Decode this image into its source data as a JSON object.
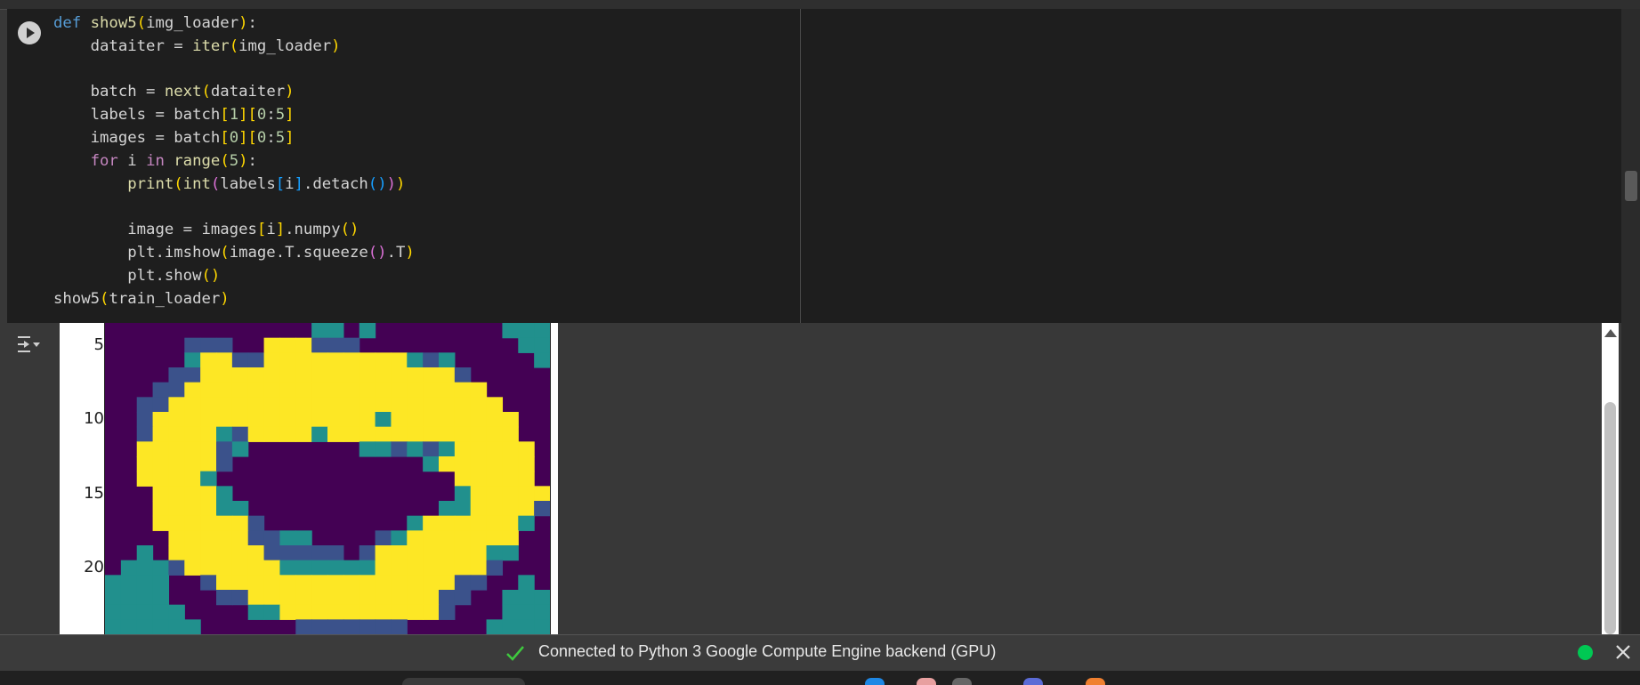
{
  "cell": {
    "code_lines": [
      [
        {
          "t": "def ",
          "c": "kw"
        },
        {
          "t": "show5",
          "c": "fn"
        },
        {
          "t": "(",
          "c": "b1"
        },
        {
          "t": "img_loader"
        },
        {
          "t": ")",
          "c": "b1"
        },
        {
          "t": ":"
        }
      ],
      [
        {
          "t": "    dataiter = "
        },
        {
          "t": "iter",
          "c": "fn"
        },
        {
          "t": "(",
          "c": "b1"
        },
        {
          "t": "img_loader"
        },
        {
          "t": ")",
          "c": "b1"
        }
      ],
      [
        {
          "t": ""
        }
      ],
      [
        {
          "t": "    batch = "
        },
        {
          "t": "next",
          "c": "fn"
        },
        {
          "t": "(",
          "c": "b1"
        },
        {
          "t": "dataiter"
        },
        {
          "t": ")",
          "c": "b1"
        }
      ],
      [
        {
          "t": "    labels = batch"
        },
        {
          "t": "[",
          "c": "b1"
        },
        {
          "t": "1",
          "c": "num"
        },
        {
          "t": "]",
          "c": "b1"
        },
        {
          "t": "[",
          "c": "b1"
        },
        {
          "t": "0",
          "c": "num"
        },
        {
          "t": ":"
        },
        {
          "t": "5",
          "c": "num"
        },
        {
          "t": "]",
          "c": "b1"
        }
      ],
      [
        {
          "t": "    images = batch"
        },
        {
          "t": "[",
          "c": "b1"
        },
        {
          "t": "0",
          "c": "num"
        },
        {
          "t": "]",
          "c": "b1"
        },
        {
          "t": "[",
          "c": "b1"
        },
        {
          "t": "0",
          "c": "num"
        },
        {
          "t": ":"
        },
        {
          "t": "5",
          "c": "num"
        },
        {
          "t": "]",
          "c": "b1"
        }
      ],
      [
        {
          "t": "    "
        },
        {
          "t": "for",
          "c": "ctl"
        },
        {
          "t": " i "
        },
        {
          "t": "in",
          "c": "ctl"
        },
        {
          "t": " "
        },
        {
          "t": "range",
          "c": "fn"
        },
        {
          "t": "(",
          "c": "b1"
        },
        {
          "t": "5",
          "c": "num"
        },
        {
          "t": ")",
          "c": "b1"
        },
        {
          "t": ":"
        }
      ],
      [
        {
          "t": "        "
        },
        {
          "t": "print",
          "c": "fn"
        },
        {
          "t": "(",
          "c": "b1"
        },
        {
          "t": "int",
          "c": "fn"
        },
        {
          "t": "(",
          "c": "b2"
        },
        {
          "t": "labels"
        },
        {
          "t": "[",
          "c": "b3"
        },
        {
          "t": "i"
        },
        {
          "t": "]",
          "c": "b3"
        },
        {
          "t": ".detach"
        },
        {
          "t": "()",
          "c": "b3"
        },
        {
          "t": ")",
          "c": "b2"
        },
        {
          "t": ")",
          "c": "b1"
        }
      ],
      [
        {
          "t": ""
        }
      ],
      [
        {
          "t": "        image = images"
        },
        {
          "t": "[",
          "c": "b1"
        },
        {
          "t": "i"
        },
        {
          "t": "]",
          "c": "b1"
        },
        {
          "t": ".numpy"
        },
        {
          "t": "()",
          "c": "b1"
        }
      ],
      [
        {
          "t": "        plt.imshow"
        },
        {
          "t": "(",
          "c": "b1"
        },
        {
          "t": "image.T.squeeze"
        },
        {
          "t": "()",
          "c": "b2"
        },
        {
          "t": ".T"
        },
        {
          "t": ")",
          "c": "b1"
        }
      ],
      [
        {
          "t": "        plt.show"
        },
        {
          "t": "()",
          "c": "b1"
        }
      ],
      [
        {
          "t": "show5"
        },
        {
          "t": "(",
          "c": "b1"
        },
        {
          "t": "train_loader"
        },
        {
          "t": ")",
          "c": "b1"
        }
      ]
    ]
  },
  "output": {
    "yticks": [
      {
        "label": "5",
        "value": 5
      },
      {
        "label": "10",
        "value": 10
      },
      {
        "label": "15",
        "value": 15
      },
      {
        "label": "20",
        "value": 20
      }
    ],
    "image_rows": [
      "0000000000000WW0W00000000WWW",
      "00000MMM00YYYMMM0000000000WW",
      "00000WYYMMYYYYYYYYYWMW00000W",
      "0000MMYYYYYYYYYYYYYYYYM00000",
      "000MMYYYYYYYYYYYYYYYYYYY0000",
      "00MMYYYYYYYYYYYYYYYYYYYYY000",
      "00MYYYYYYYYYYYYYYWYYYYYYYY00",
      "00MYYYYWMYYYYWYYYYYYYYYYYY00",
      "00YYYYYMW0000000WWMWMWYYYYY0",
      "00YYYYYM000000000000WYYYYYY0",
      "00YYYYW000000000000000YYYYY0",
      "000YYYYW00000000000000WYYYYY",
      "000YYYYWW000000000000WWYYYYM",
      "000YYYYYYM000000000WYYYYYYW0",
      "0000YYYYYMMWW0000MWYYYYYYY00",
      "00W0YYYYYYMMMMM0MYYYYYYYWW00",
      "0WWWMYYYYYYWWWWWWYYYYYYYM000",
      "WWWW00MYYYYYYYYYYYYYYYMM00W0",
      "WWWW000MMYYYYYYYYYYYYMM00WWW",
      "WWWWW0000WWYYYYYYYYYYM000WWW",
      "WWWWWW000000MMMMMMM00000WWWW"
    ],
    "palette": {
      "0": "#440154",
      "M": "#3b528b",
      "W": "#21908d",
      "Y": "#fde725"
    }
  },
  "status": {
    "text": "Connected to Python 3 Google Compute Engine backend (GPU)",
    "dot_color": "#00c853"
  }
}
